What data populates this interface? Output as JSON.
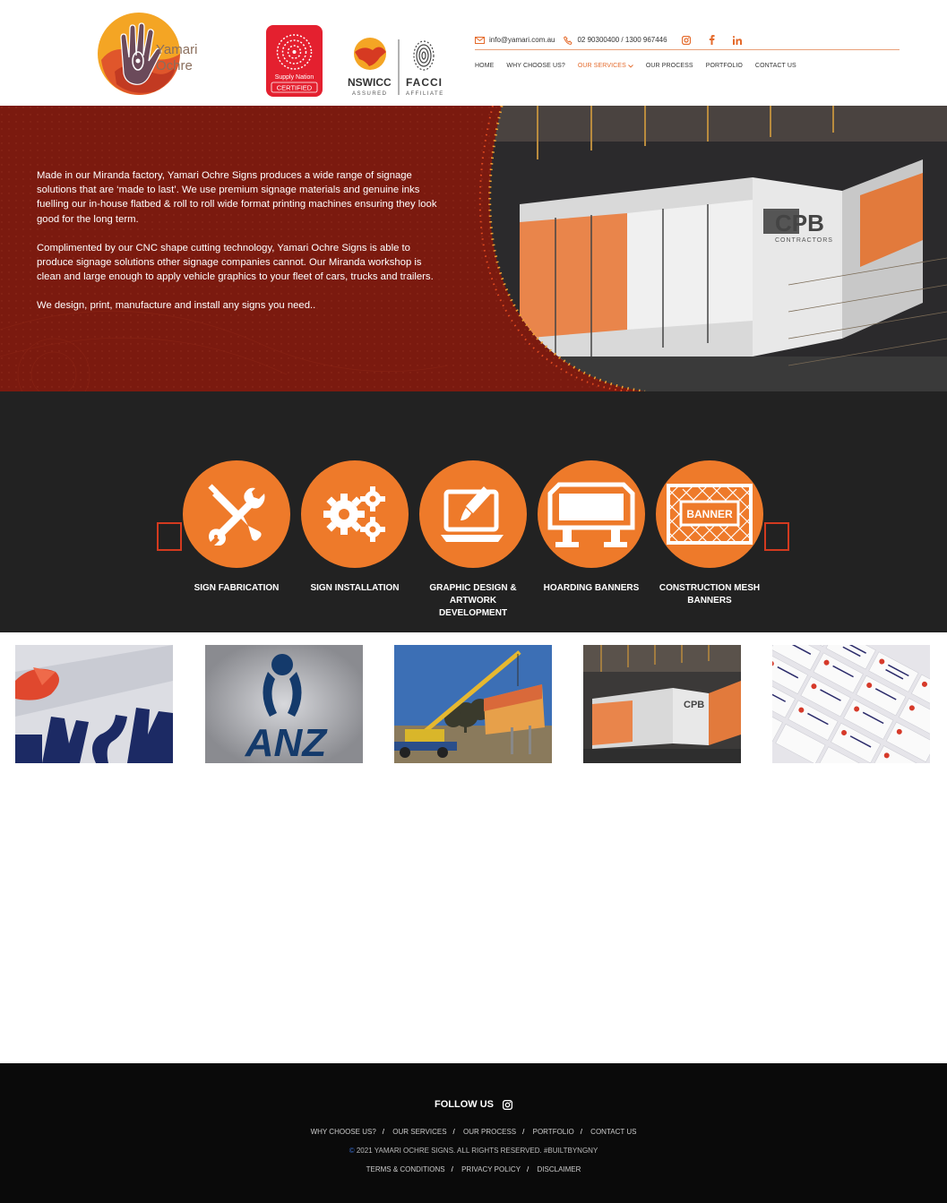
{
  "header": {
    "logo_text_1": "Yamari",
    "logo_text_2": "Ochre",
    "supply_line1": "Supply Nation",
    "supply_line2": "CERTIFIED",
    "nswicc_title": "NSWICC",
    "nswicc_sub": "ASSURED",
    "facci_title": "FACCI",
    "facci_sub": "AFFILIATE",
    "email": "info@yamari.com.au",
    "phone": "02 90300400 /  1300 967446",
    "nav": [
      "HOME",
      "WHY CHOOSE US?",
      "OUR SERVICES",
      "OUR PROCESS",
      "PORTFOLIO",
      "CONTACT US"
    ],
    "accent_color": "#e46a2b"
  },
  "hero": {
    "paragraphs": [
      "Made in our Miranda factory, Yamari Ochre Signs produces a wide range of signage solutions that are ‘made to last’. We use premium signage materials and genuine inks fuelling our in-house flatbed & roll to roll wide format printing machines ensuring they look good for the long term.",
      "Complimented by our CNC shape cutting technology, Yamari Ochre Signs is able to produce signage solutions other signage companies cannot. Our Miranda workshop is clean and large enough to apply vehicle graphics to your fleet of cars, trucks and trailers.",
      "We design, print, manufacture and install any signs you need.."
    ],
    "photo_sign_text": "CPB",
    "photo_sign_sub": "CONTRACTORS",
    "background_color": "#7b1a0f"
  },
  "services": {
    "items": [
      {
        "label": "SIGN FABRICATION",
        "icon": "tools-icon"
      },
      {
        "label": "SIGN INSTALLATION",
        "icon": "gears-icon"
      },
      {
        "label": "GRAPHIC DESIGN & ARTWORK DEVELOPMENT",
        "icon": "design-monitor-icon"
      },
      {
        "label": "HOARDING BANNERS",
        "icon": "hoarding-icon"
      },
      {
        "label": "CONSTRUCTION MESH BANNERS",
        "icon": "mesh-banner-icon"
      }
    ],
    "banner_word": "BANNER",
    "circle_color": "#ee7a2a"
  },
  "gallery": {
    "anz_text": "ANZ"
  },
  "footer": {
    "follow_label": "FOLLOW US",
    "links": [
      "WHY CHOOSE US?",
      "OUR SERVICES",
      "OUR PROCESS",
      "PORTFOLIO",
      "CONTACT US"
    ],
    "copyright": "2021 YAMARI OCHRE SIGNS. ALL RIGHTS RESERVED. #BUILTBYNGNY",
    "legal": [
      "TERMS & CONDITIONS",
      "PRIVACY POLICY",
      "DISCLAIMER"
    ]
  }
}
